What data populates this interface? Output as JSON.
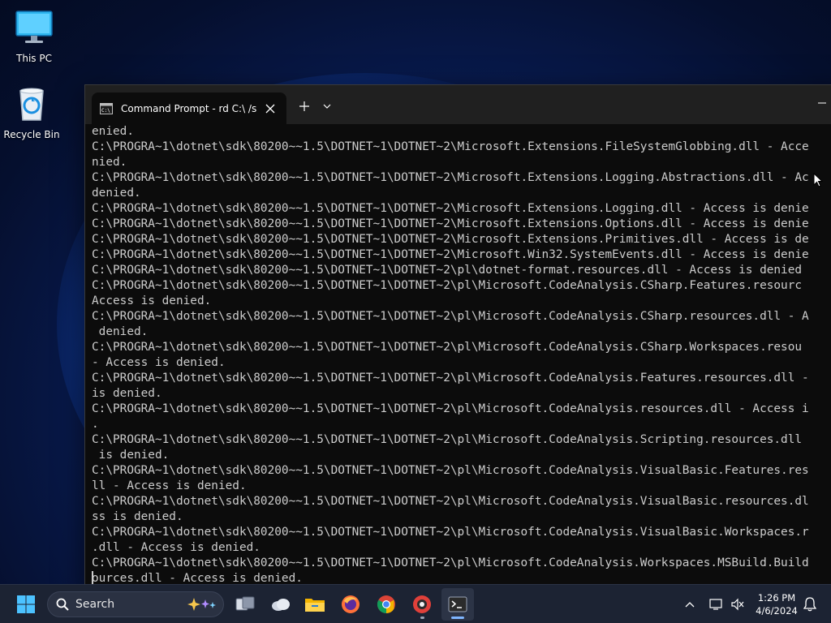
{
  "desktop": {
    "icons": [
      {
        "label": "This PC"
      },
      {
        "label": "Recycle Bin"
      }
    ]
  },
  "terminal": {
    "tab_title": "Command Prompt - rd  C:\\ /s",
    "lines": [
      "enied.",
      "C:\\PROGRA~1\\dotnet\\sdk\\80200~~1.5\\DOTNET~1\\DOTNET~2\\Microsoft.Extensions.FileSystemGlobbing.dll - Acce",
      "nied.",
      "C:\\PROGRA~1\\dotnet\\sdk\\80200~~1.5\\DOTNET~1\\DOTNET~2\\Microsoft.Extensions.Logging.Abstractions.dll - Ac",
      "denied.",
      "C:\\PROGRA~1\\dotnet\\sdk\\80200~~1.5\\DOTNET~1\\DOTNET~2\\Microsoft.Extensions.Logging.dll - Access is denie",
      "C:\\PROGRA~1\\dotnet\\sdk\\80200~~1.5\\DOTNET~1\\DOTNET~2\\Microsoft.Extensions.Options.dll - Access is denie",
      "C:\\PROGRA~1\\dotnet\\sdk\\80200~~1.5\\DOTNET~1\\DOTNET~2\\Microsoft.Extensions.Primitives.dll - Access is de",
      "C:\\PROGRA~1\\dotnet\\sdk\\80200~~1.5\\DOTNET~1\\DOTNET~2\\Microsoft.Win32.SystemEvents.dll - Access is denie",
      "C:\\PROGRA~1\\dotnet\\sdk\\80200~~1.5\\DOTNET~1\\DOTNET~2\\pl\\dotnet-format.resources.dll - Access is denied",
      "C:\\PROGRA~1\\dotnet\\sdk\\80200~~1.5\\DOTNET~1\\DOTNET~2\\pl\\Microsoft.CodeAnalysis.CSharp.Features.resourc",
      "Access is denied.",
      "C:\\PROGRA~1\\dotnet\\sdk\\80200~~1.5\\DOTNET~1\\DOTNET~2\\pl\\Microsoft.CodeAnalysis.CSharp.resources.dll - A",
      " denied.",
      "C:\\PROGRA~1\\dotnet\\sdk\\80200~~1.5\\DOTNET~1\\DOTNET~2\\pl\\Microsoft.CodeAnalysis.CSharp.Workspaces.resou",
      "- Access is denied.",
      "C:\\PROGRA~1\\dotnet\\sdk\\80200~~1.5\\DOTNET~1\\DOTNET~2\\pl\\Microsoft.CodeAnalysis.Features.resources.dll -",
      "is denied.",
      "C:\\PROGRA~1\\dotnet\\sdk\\80200~~1.5\\DOTNET~1\\DOTNET~2\\pl\\Microsoft.CodeAnalysis.resources.dll - Access i",
      ".",
      "C:\\PROGRA~1\\dotnet\\sdk\\80200~~1.5\\DOTNET~1\\DOTNET~2\\pl\\Microsoft.CodeAnalysis.Scripting.resources.dll",
      " is denied.",
      "C:\\PROGRA~1\\dotnet\\sdk\\80200~~1.5\\DOTNET~1\\DOTNET~2\\pl\\Microsoft.CodeAnalysis.VisualBasic.Features.res",
      "ll - Access is denied.",
      "C:\\PROGRA~1\\dotnet\\sdk\\80200~~1.5\\DOTNET~1\\DOTNET~2\\pl\\Microsoft.CodeAnalysis.VisualBasic.resources.dl",
      "ss is denied.",
      "C:\\PROGRA~1\\dotnet\\sdk\\80200~~1.5\\DOTNET~1\\DOTNET~2\\pl\\Microsoft.CodeAnalysis.VisualBasic.Workspaces.r",
      ".dll - Access is denied.",
      "C:\\PROGRA~1\\dotnet\\sdk\\80200~~1.5\\DOTNET~1\\DOTNET~2\\pl\\Microsoft.CodeAnalysis.Workspaces.MSBuild.Build",
      "ources.dll - Access is denied."
    ]
  },
  "taskbar": {
    "search_label": "Search",
    "clock_time": "1:26 PM",
    "clock_date": "4/6/2024"
  },
  "colors": {
    "console_bg": "#0c0c0c",
    "console_fg": "#cccccc",
    "titlebar_bg": "#202020",
    "taskbar_bg": "#1c2333",
    "accent": "#7fb6ff"
  }
}
